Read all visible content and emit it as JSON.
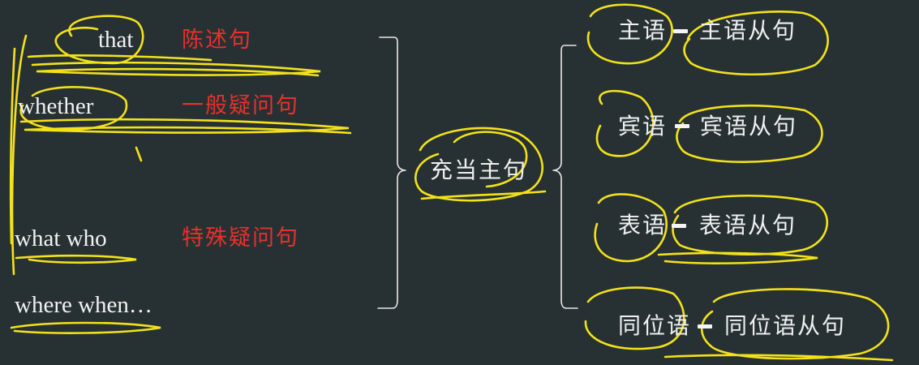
{
  "colors": {
    "background": "#273133",
    "text": "#f2f2f2",
    "red_text": "#e8302c",
    "highlighter": "#f3e21a"
  },
  "left": {
    "rows": [
      {
        "conjunction": "that",
        "sentence_type": "陈述句"
      },
      {
        "conjunction": "whether",
        "sentence_type": "一般疑问句"
      },
      {
        "conjunction": "what who",
        "sentence_type": "特殊疑问句"
      },
      {
        "conjunction": "where when…",
        "sentence_type": ""
      }
    ]
  },
  "center": {
    "label": "充当主句"
  },
  "right": {
    "items": [
      {
        "role": "主语",
        "arrow_icon": "arrow-right-icon",
        "clause": "主语从句"
      },
      {
        "role": "宾语",
        "arrow_icon": "arrow-right-icon",
        "clause": "宾语从句"
      },
      {
        "role": "表语",
        "arrow_icon": "arrow-right-icon",
        "clause": "表语从句"
      },
      {
        "role": "同位语",
        "arrow_icon": "arrow-right-icon",
        "clause": "同位语从句"
      }
    ]
  }
}
